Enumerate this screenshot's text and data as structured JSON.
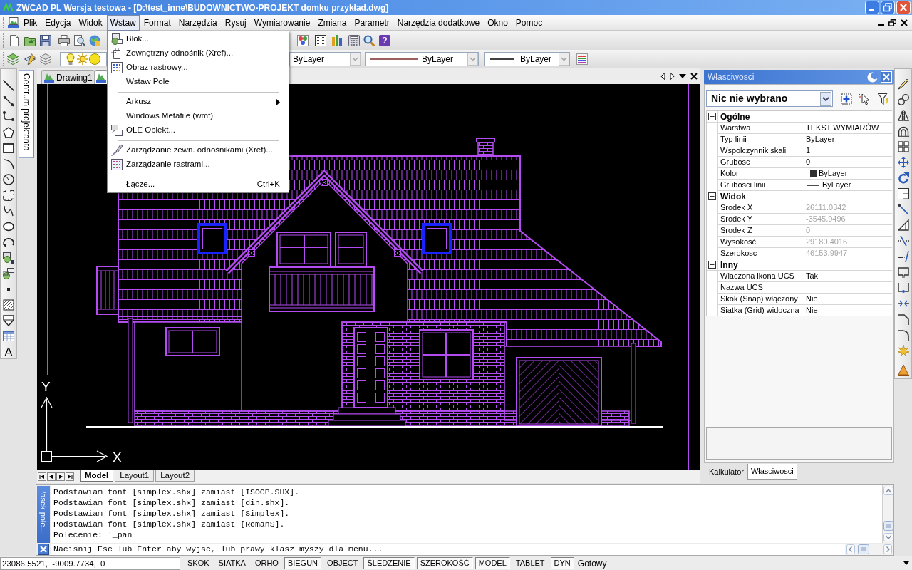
{
  "window": {
    "title": "ZWCAD PL Wersja testowa - [D:\\test_inne\\BUDOWNICTWO-PROJEKT domku przykład.dwg]"
  },
  "menu_bar": [
    {
      "label": "Plik",
      "selected": false
    },
    {
      "label": "Edycja",
      "selected": false
    },
    {
      "label": "Widok",
      "selected": false
    },
    {
      "label": "Wstaw",
      "selected": true
    },
    {
      "label": "Format",
      "selected": false
    },
    {
      "label": "Narzędzia",
      "selected": false
    },
    {
      "label": "Rysuj",
      "selected": false
    },
    {
      "label": "Wymiarowanie",
      "selected": false
    },
    {
      "label": "Zmiana",
      "selected": false
    },
    {
      "label": "Parametr",
      "selected": false
    },
    {
      "label": "Narzędzia dodatkowe",
      "selected": false
    },
    {
      "label": "Okno",
      "selected": false
    },
    {
      "label": "Pomoc",
      "selected": false
    }
  ],
  "open_menu": {
    "items": [
      {
        "kind": "item",
        "label": "Blok..."
      },
      {
        "kind": "item",
        "label": "Zewnętrzny odnośnik (Xref)..."
      },
      {
        "kind": "item",
        "label": "Obraz rastrowy..."
      },
      {
        "kind": "item",
        "label": "Wstaw Pole"
      },
      {
        "kind": "separator"
      },
      {
        "kind": "submenu",
        "label": "Arkusz"
      },
      {
        "kind": "item",
        "label": "Windows Metafile (wmf)"
      },
      {
        "kind": "item",
        "label": "OLE Obiekt..."
      },
      {
        "kind": "separator"
      },
      {
        "kind": "item",
        "label": "Zarządzanie zewn. odnośnikami (Xref)..."
      },
      {
        "kind": "item",
        "label": "Zarządzanie rastrami..."
      },
      {
        "kind": "separator"
      },
      {
        "kind": "item",
        "label": "Łącze...",
        "shortcut": "Ctrl+K"
      }
    ]
  },
  "toolbar": {
    "help_glyph": "?",
    "color_combo": "ByLayer",
    "linetype_combo": "ByLayer",
    "lineweight_combo": "ByLayer"
  },
  "draw_toolbar": {
    "text_tool_glyph": "A"
  },
  "design_center_tab": {
    "label": "Centrum projektanta"
  },
  "drawing_tabs": [
    {
      "label": "Drawing1",
      "selected": false
    },
    {
      "selected": true
    }
  ],
  "canvas": {
    "ucs": {
      "x_label": "X",
      "y_label": "Y"
    }
  },
  "layout_tabs": [
    {
      "label": "Model",
      "selected": true
    },
    {
      "label": "Layout1",
      "selected": false
    },
    {
      "label": "Layout2",
      "selected": false
    }
  ],
  "properties": {
    "title": "Własciwosci",
    "selection": "Nic nie wybrano",
    "sections": [
      {
        "title": "Ogólne",
        "expanded": true,
        "rows": [
          {
            "name": "Warstwa",
            "value": "TEKST WYMIARÓW",
            "kind": "text",
            "disabled": false
          },
          {
            "name": "Typ linii",
            "value": "ByLayer",
            "kind": "text",
            "disabled": false
          },
          {
            "name": "Wspolczynnik skali",
            "value": "1",
            "kind": "text",
            "disabled": false
          },
          {
            "name": "Grubosc",
            "value": "0",
            "kind": "text",
            "disabled": false
          },
          {
            "name": "Kolor",
            "value": "ByLayer",
            "kind": "color",
            "disabled": false
          },
          {
            "name": "Grubosci linii",
            "value": "ByLayer",
            "kind": "lineweight",
            "disabled": false
          }
        ]
      },
      {
        "title": "Widok",
        "expanded": true,
        "rows": [
          {
            "name": "Srodek X",
            "value": "26111.0342",
            "kind": "text",
            "disabled": true
          },
          {
            "name": "Srodek Y",
            "value": "-3545.9496",
            "kind": "text",
            "disabled": true
          },
          {
            "name": "Srodek Z",
            "value": "0",
            "kind": "text",
            "disabled": true
          },
          {
            "name": "Wysokość",
            "value": "29180.4016",
            "kind": "text",
            "disabled": true
          },
          {
            "name": "Szerokosc",
            "value": "46153.9947",
            "kind": "text",
            "disabled": true
          }
        ]
      },
      {
        "title": "Inny",
        "expanded": true,
        "rows": [
          {
            "name": "Wlaczona ikona UCS",
            "value": "Tak",
            "kind": "text",
            "disabled": false
          },
          {
            "name": "Nazwa UCS",
            "kind": "text"
          },
          {
            "name": "Skok (Snap) włączony",
            "value": "Nie",
            "kind": "text",
            "disabled": false
          },
          {
            "name": "Siatka (Grid) widoczna",
            "value": "Nie",
            "kind": "text",
            "disabled": false
          }
        ]
      }
    ],
    "tabs": [
      {
        "label": "Kalkulator",
        "selected": false
      },
      {
        "label": "Własciwosci",
        "selected": true
      }
    ]
  },
  "command_line": {
    "tab_label": "Pasek pole...",
    "history": [
      "Podstawiam font [simplex.shx] zamiast [ISOCP.SHX].",
      "Podstawiam font [simplex.shx] zamiast [din.shx].",
      "Podstawiam font [simplex.shx] zamiast [Simplex].",
      "Podstawiam font [simplex.shx] zamiast [RomanS].",
      "Polecenie: '_pan"
    ],
    "prompt": "Nacisnij Esc lub Enter aby wyjsc, lub prawy klasz myszy dla menu..."
  },
  "status_bar": {
    "coordinates": "23086.5521,  -9009.7734,  0",
    "toggles": [
      {
        "label": "SKOK",
        "on": false
      },
      {
        "label": "SIATKA",
        "on": false
      },
      {
        "label": "ORHO",
        "on": false
      },
      {
        "label": "BIEGUN",
        "on": true
      },
      {
        "label": "OBJECT",
        "on": false
      },
      {
        "label": "ŚLEDZENIE",
        "on": true
      },
      {
        "label": "SZEROKOŚĆ",
        "on": true
      },
      {
        "label": "MODEL",
        "on": true
      },
      {
        "label": "TABLET",
        "on": false
      },
      {
        "label": "DYN",
        "on": true
      }
    ],
    "status": "Gotowy"
  }
}
